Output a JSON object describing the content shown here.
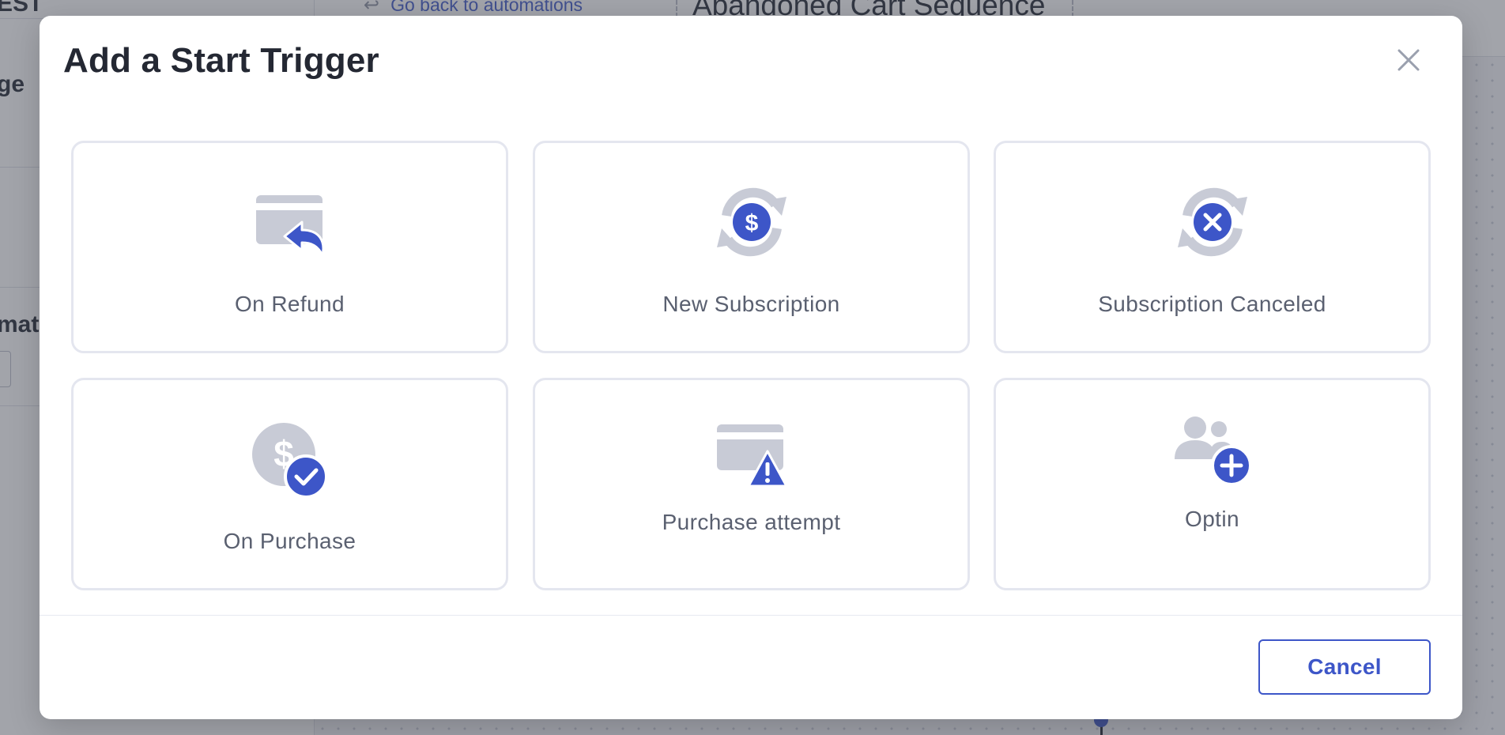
{
  "background": {
    "sidebar_partial_texts": [
      "EST",
      "ge",
      "mat"
    ],
    "back_link": "Go back to automations",
    "automation_title": "Abandoned Cart Sequence"
  },
  "modal": {
    "title": "Add a Start Trigger",
    "close_icon": "close-icon",
    "triggers": [
      {
        "label": "On Refund",
        "icon": "refund-card-icon"
      },
      {
        "label": "New Subscription",
        "icon": "subscription-dollar-icon"
      },
      {
        "label": "Subscription Canceled",
        "icon": "subscription-canceled-icon"
      },
      {
        "label": "On Purchase",
        "icon": "purchase-check-icon"
      },
      {
        "label": "Purchase attempt",
        "icon": "purchase-warning-icon"
      },
      {
        "label": "Optin",
        "icon": "optin-user-add-icon"
      }
    ],
    "cancel_label": "Cancel"
  },
  "colors": {
    "accent": "#3d56c8",
    "icon_gray": "#c8cbd6",
    "label_text": "#5a6070",
    "card_border": "#e4e6ef"
  }
}
